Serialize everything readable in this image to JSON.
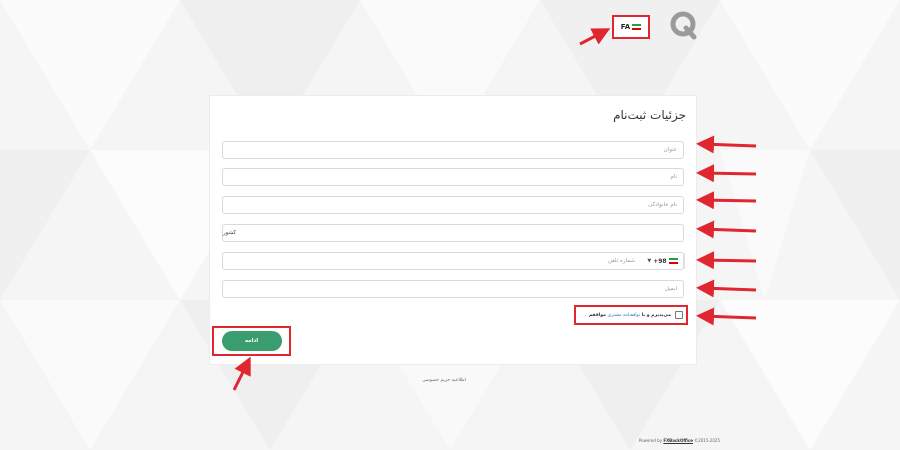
{
  "colors": {
    "accent_green": "#3a9d6f",
    "annotation_red": "#e0262e",
    "link_blue": "#2a7ab8"
  },
  "header": {
    "logo_icon": "q-logo-icon",
    "language_label": "FA",
    "language_flag": "iran-flag-icon"
  },
  "form": {
    "title": "جزئیات ثبت‌نام",
    "title_field": {
      "placeholder": "عنوان"
    },
    "first_name": {
      "placeholder": "نام"
    },
    "last_name": {
      "placeholder": "نام خانوادگی"
    },
    "country": {
      "value": "کشور"
    },
    "phone": {
      "country_code": "+98",
      "flag": "iran-flag-icon",
      "placeholder": "شماره تلفن"
    },
    "email": {
      "placeholder": "ایمیل"
    },
    "terms": {
      "prefix": "می‌پذیرم و با",
      "link_text": "توافقنامه مشتری",
      "suffix": "موافقم"
    },
    "continue_label": "ادامه"
  },
  "privacy_link": "اطلاعیه حریم خصوصی",
  "footer": {
    "prefix": "Powered by",
    "brand": "FXBackOffice",
    "years": "©2015-2025"
  }
}
